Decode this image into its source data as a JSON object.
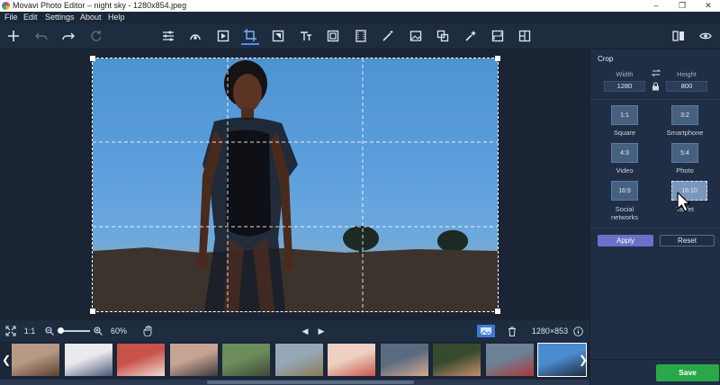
{
  "window": {
    "title": "Movavi Photo Editor – night sky - 1280x854.jpeg",
    "minimize": "–",
    "maximize": "❐",
    "close": "✕"
  },
  "menu": {
    "items": [
      "File",
      "Edit",
      "Settings",
      "About",
      "Help"
    ]
  },
  "toolbar": {
    "tools": [
      {
        "name": "add-icon"
      },
      {
        "name": "undo-icon"
      },
      {
        "name": "redo-icon"
      },
      {
        "name": "reset-history-icon"
      },
      {
        "name": "adjust-icon"
      },
      {
        "name": "retouch-icon"
      },
      {
        "name": "effects-icon"
      },
      {
        "name": "crop-icon",
        "active": true
      },
      {
        "name": "objects-icon"
      },
      {
        "name": "text-icon"
      },
      {
        "name": "frames-icon"
      },
      {
        "name": "film-icon"
      },
      {
        "name": "magic-wand-icon"
      },
      {
        "name": "image-icon"
      },
      {
        "name": "layers-icon"
      },
      {
        "name": "sparkle-icon"
      },
      {
        "name": "resize-icon"
      },
      {
        "name": "split-icon"
      }
    ],
    "right": [
      {
        "name": "compare-icon"
      },
      {
        "name": "eye-icon"
      }
    ]
  },
  "bottombar": {
    "one_to_one": "1:1",
    "zoom_percent": "60%",
    "zoom_fraction": 0.05,
    "image_size": "1280×853",
    "prev": "◀",
    "next": "▶"
  },
  "filmstrip": {
    "thumbnails": [
      {
        "name": "thumb-1",
        "colors": [
          "#b79a84",
          "#5d3f30"
        ]
      },
      {
        "name": "thumb-2",
        "colors": [
          "#e9e9ee",
          "#4a5874"
        ]
      },
      {
        "name": "thumb-3",
        "colors": [
          "#c9524a",
          "#f1dcd4"
        ]
      },
      {
        "name": "thumb-4",
        "colors": [
          "#c7a394",
          "#3d3a3a"
        ]
      },
      {
        "name": "thumb-5",
        "colors": [
          "#6c8c5c",
          "#3e4a36"
        ]
      },
      {
        "name": "thumb-6",
        "colors": [
          "#96a7b8",
          "#8b7c52"
        ]
      },
      {
        "name": "thumb-7",
        "colors": [
          "#ecd1c2",
          "#c8574b"
        ]
      },
      {
        "name": "thumb-8",
        "colors": [
          "#5a6b80",
          "#d4a98f"
        ]
      },
      {
        "name": "thumb-9",
        "colors": [
          "#384a2e",
          "#c88e6a"
        ]
      },
      {
        "name": "thumb-10",
        "colors": [
          "#6d8196",
          "#a93a36"
        ]
      },
      {
        "name": "thumb-11",
        "colors": [
          "#4b8ccf",
          "#1e2b3a"
        ],
        "selected": true
      }
    ]
  },
  "panel": {
    "title": "Crop",
    "width_label": "Width",
    "height_label": "Height",
    "width_value": "1280",
    "height_value": "800",
    "ratios": [
      {
        "ratio": "1:1",
        "label": "Square"
      },
      {
        "ratio": "3:2",
        "label": "Smartphone"
      },
      {
        "ratio": "4:3",
        "label": "Video"
      },
      {
        "ratio": "5:4",
        "label": "Photo"
      },
      {
        "ratio": "16:9",
        "label": "Social\nnetworks"
      },
      {
        "ratio": "16:10",
        "label": "Tablet"
      }
    ],
    "apply": "Apply",
    "reset": "Reset",
    "save": "Save"
  },
  "colors": {
    "accent": "#4b8ee8",
    "apply": "#6a71c9",
    "save": "#29a84a",
    "panel_bg": "#1f2e44"
  }
}
